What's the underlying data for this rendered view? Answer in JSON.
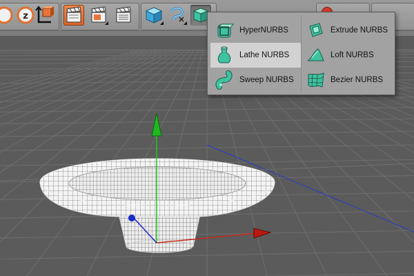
{
  "toolbar": {
    "buttons": [
      {
        "id": "move",
        "icon": "move-tool-icon"
      },
      {
        "id": "scale",
        "icon": "scale-tool-icon",
        "letter": "z"
      },
      {
        "id": "coord",
        "icon": "coordinate-system-icon"
      },
      {
        "id": "render-view",
        "icon": "render-view-icon",
        "state": "active"
      },
      {
        "id": "render-picture",
        "icon": "render-picture-icon"
      },
      {
        "id": "render-settings",
        "icon": "render-settings-icon"
      },
      {
        "id": "cube",
        "icon": "cube-primitive-icon"
      },
      {
        "id": "spline",
        "icon": "spline-pen-icon"
      },
      {
        "id": "nurbs",
        "icon": "nurbs-generator-icon",
        "state": "pressed"
      }
    ]
  },
  "nurbs_menu": {
    "items": [
      {
        "label": "HyperNURBS",
        "icon": "hypernurbs-icon"
      },
      {
        "label": "Extrude NURBS",
        "icon": "extrude-nurbs-icon"
      },
      {
        "label": "Lathe NURBS",
        "icon": "lathe-nurbs-icon",
        "highlighted": true
      },
      {
        "label": "Loft NURBS",
        "icon": "loft-nurbs-icon"
      },
      {
        "label": "Sweep NURBS",
        "icon": "sweep-nurbs-icon"
      },
      {
        "label": "Bezier NURBS",
        "icon": "bezier-nurbs-icon"
      }
    ]
  },
  "colors": {
    "accent_orange": "#e8743a",
    "menu_bg": "#a2a2a2",
    "menu_highlight": "#d2d2d2",
    "viewport_bg": "#5b5b5b",
    "grid_line": "#6e6e6e",
    "axis_y": "#1fc81f",
    "axis_x": "#c82a1a",
    "axis_z": "#1a2ac8",
    "nurbs_icon": "#3fc2a0"
  }
}
